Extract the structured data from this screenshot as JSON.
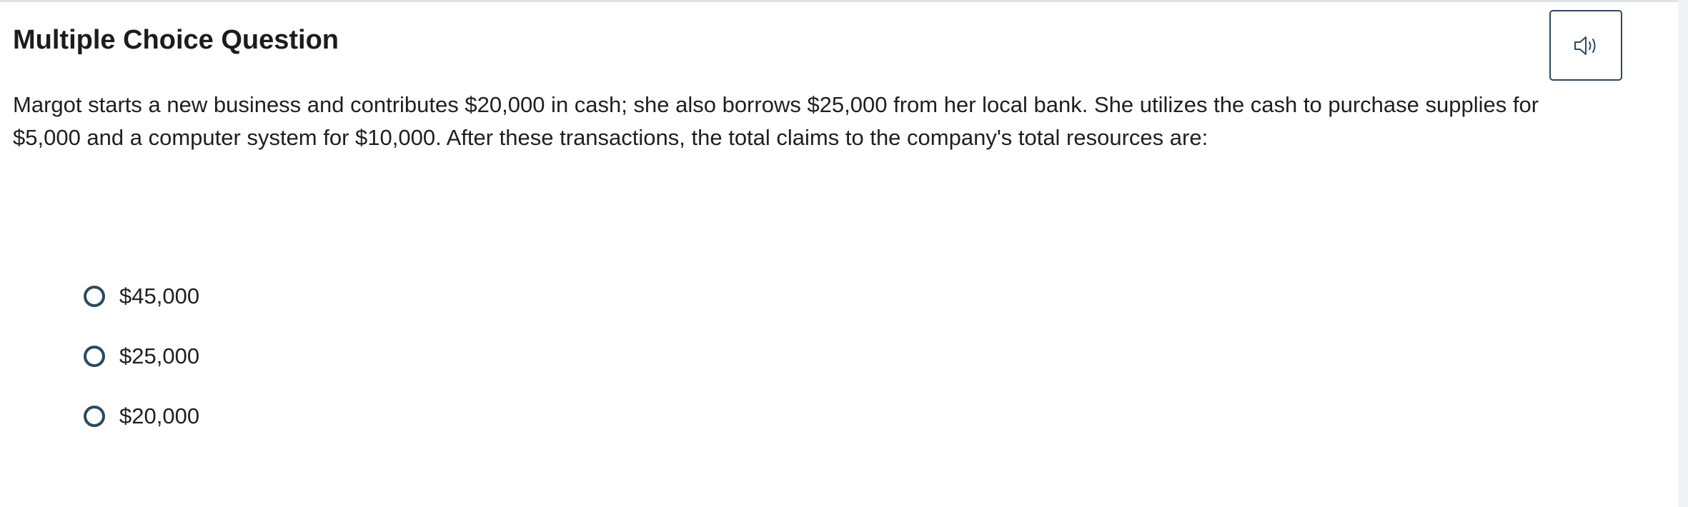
{
  "question": {
    "type_heading": "Multiple Choice Question",
    "prompt": "Margot starts a new business and contributes $20,000 in cash; she also borrows $25,000 from her local bank. She utilizes the cash to purchase supplies for $5,000 and a computer system for $10,000. After these transactions, the total claims to the company's total resources are:",
    "choices": [
      {
        "label": "$45,000"
      },
      {
        "label": "$25,000"
      },
      {
        "label": "$20,000"
      }
    ]
  },
  "controls": {
    "audio_icon": "speaker-icon"
  },
  "colors": {
    "accent": "#2d4a5d",
    "text": "#1f1f1f",
    "divider": "#dfe3e6"
  }
}
